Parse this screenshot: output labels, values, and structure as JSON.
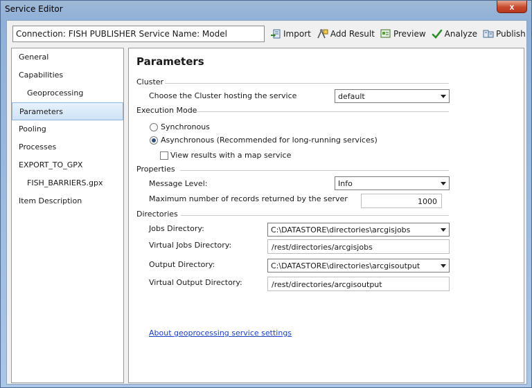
{
  "window": {
    "title": "Service Editor",
    "close_glyph": "x"
  },
  "connection_text": "Connection: FISH PUBLISHER  Service Name: Model",
  "toolbar": {
    "import": "Import",
    "add_result": "Add Result",
    "preview": "Preview",
    "analyze": "Analyze",
    "publish": "Publish"
  },
  "sidebar": {
    "items": [
      {
        "label": "General"
      },
      {
        "label": "Capabilities"
      },
      {
        "label": "Geoprocessing"
      },
      {
        "label": "Parameters"
      },
      {
        "label": "Pooling"
      },
      {
        "label": "Processes"
      },
      {
        "label": "EXPORT_TO_GPX"
      },
      {
        "label": "FISH_BARRIERS.gpx"
      },
      {
        "label": "Item Description"
      }
    ],
    "selected": "Parameters"
  },
  "main": {
    "title": "Parameters",
    "cluster": {
      "heading": "Cluster",
      "choose_label": "Choose the Cluster hosting the service",
      "value": "default"
    },
    "execution": {
      "heading": "Execution Mode",
      "sync_label": "Synchronous",
      "async_label": "Asynchronous (Recommended for long-running services)",
      "map_service_label": "View results with a map service",
      "mode_selected": "asynchronous"
    },
    "properties": {
      "heading": "Properties",
      "message_level_label": "Message Level:",
      "message_level_value": "Info",
      "max_records_label": "Maximum number of records returned by the server",
      "max_records_value": "1000"
    },
    "directories": {
      "heading": "Directories",
      "jobs_label": "Jobs Directory:",
      "jobs_value": "C:\\DATASTORE\\directories\\arcgisjobs",
      "virtual_jobs_label": "Virtual Jobs Directory:",
      "virtual_jobs_value": "/rest/directories/arcgisjobs",
      "output_label": "Output Directory:",
      "output_value": "C:\\DATASTORE\\directories\\arcgisoutput",
      "virtual_output_label": "Virtual Output Directory:",
      "virtual_output_value": "/rest/directories/arcgisoutput"
    },
    "about_link": "About geoprocessing service settings"
  },
  "icons": {
    "import": "import-icon",
    "add_result": "add-result-icon",
    "preview": "preview-icon",
    "analyze": "check-icon",
    "publish": "publish-icon",
    "collapse": "chevron-up-icon"
  }
}
